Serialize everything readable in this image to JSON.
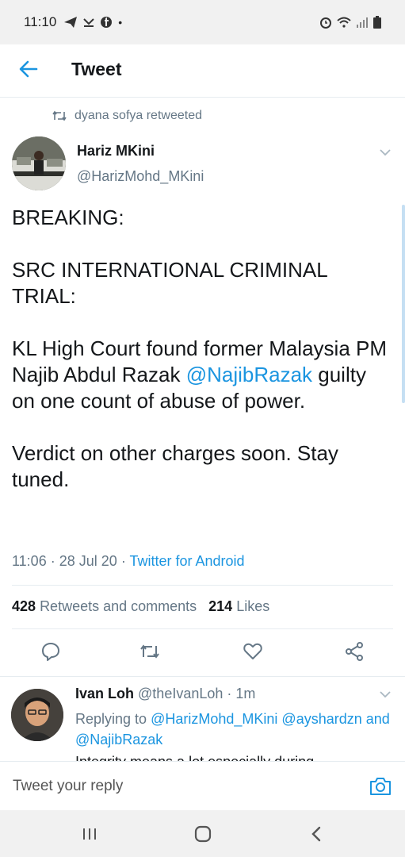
{
  "status_bar": {
    "time": "11:10"
  },
  "app_bar": {
    "title": "Tweet"
  },
  "retweet": {
    "text": "dyana sofya retweeted"
  },
  "tweet": {
    "author_name": "Hariz MKini",
    "author_handle": "@HarizMohd_MKini",
    "line1": "BREAKING:",
    "line2": "SRC INTERNATIONAL CRIMINAL TRIAL:",
    "line3_before": "KL High Court found former Malaysia PM Najib Abdul Razak ",
    "line3_mention": "@NajibRazak",
    "line3_after": " guilty on one count of abuse of power.",
    "line4": "Verdict on other charges soon. Stay tuned.",
    "time": "11:06",
    "date": "28 Jul 20",
    "source": "Twitter for Android",
    "retweets_count": "428",
    "retweets_label": "Retweets and comments",
    "likes_count": "214",
    "likes_label": "Likes"
  },
  "reply": {
    "author_name": "Ivan Loh",
    "author_handle": "@theIvanLoh",
    "age": "1m",
    "replying_prefix": "Replying to",
    "mention1": "@HarizMohd_MKini",
    "mention2": "@ayshardzn",
    "and": "and",
    "mention3": "@NajibRazak",
    "preview": "Integrity means a lot especially during"
  },
  "composer": {
    "placeholder": "Tweet your reply"
  },
  "icons": {
    "back": "arrow-left-icon",
    "retweet": "retweet-icon",
    "caret": "chevron-down-icon",
    "reply": "reply-icon",
    "like": "heart-icon",
    "share": "share-icon",
    "camera": "camera-icon"
  },
  "colors": {
    "accent": "#1b95e0",
    "secondary_text": "#657786",
    "text": "#14171a"
  }
}
